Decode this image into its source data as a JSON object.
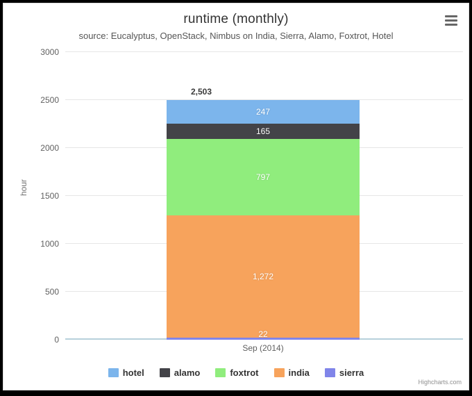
{
  "chart_data": {
    "type": "bar",
    "subtype": "stacked-column",
    "title": "runtime (monthly)",
    "subtitle": "source: Eucalyptus, OpenStack, Nimbus on India, Sierra, Alamo, Foxtrot, Hotel",
    "xlabel": "",
    "ylabel": "hour",
    "categories": [
      "Sep (2014)"
    ],
    "ylim": [
      0,
      3000
    ],
    "y_ticks": [
      0,
      500,
      1000,
      1500,
      2000,
      2500,
      3000
    ],
    "y_tick_labels": [
      "0",
      "500",
      "1000",
      "1500",
      "2000",
      "2500",
      "3000"
    ],
    "grid": true,
    "legend_position": "bottom",
    "stack_totals": [
      2503
    ],
    "stack_total_labels": [
      "2,503"
    ],
    "series": [
      {
        "name": "hotel",
        "color": "#7CB5EC",
        "values": [
          247
        ],
        "data_labels": [
          "247"
        ]
      },
      {
        "name": "alamo",
        "color": "#434348",
        "values": [
          165
        ],
        "data_labels": [
          "165"
        ]
      },
      {
        "name": "foxtrot",
        "color": "#90ED7D",
        "values": [
          797
        ],
        "data_labels": [
          "797"
        ]
      },
      {
        "name": "india",
        "color": "#F7A35C",
        "values": [
          1272
        ],
        "data_labels": [
          "1,272"
        ]
      },
      {
        "name": "sierra",
        "color": "#8085E9",
        "values": [
          22
        ],
        "data_labels": [
          "22"
        ]
      }
    ],
    "stack_order_bottom_to_top": [
      "sierra",
      "india",
      "foxtrot",
      "alamo",
      "hotel"
    ]
  },
  "toolbar": {
    "export_menu_icon": "hamburger-menu-icon"
  },
  "credits": {
    "text": "Highcharts.com"
  }
}
